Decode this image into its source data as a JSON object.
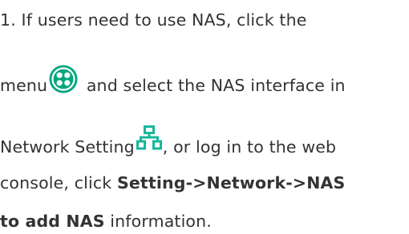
{
  "instruction": {
    "line1": {
      "text": "1. If users need to use NAS, click the"
    },
    "line2": {
      "before_icon": "menu",
      "after_icon": " and select the NAS interface in"
    },
    "line3": {
      "before_icon": "Network Setting",
      "after_icon": ", or log in to the web"
    },
    "line4": {
      "text": "console, click ",
      "bold": "Setting->Network->NAS"
    },
    "line5": {
      "bold": "to add NAS",
      "text": " information."
    }
  },
  "icons": {
    "menu": "menu-icon",
    "network_setting": "network-setting-icon"
  },
  "colors": {
    "text": "#333333",
    "menu_icon": "#00a67e",
    "network_icon": "#17b79b"
  }
}
